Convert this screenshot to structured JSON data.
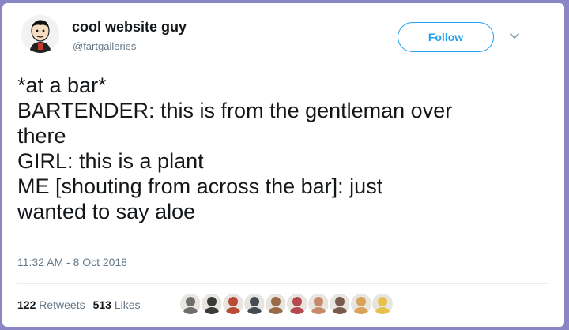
{
  "user": {
    "display_name": "cool website guy",
    "handle": "@fartgalleries"
  },
  "follow_button": {
    "label": "Follow"
  },
  "tweet": {
    "lines": [
      "*at a bar*",
      "BARTENDER: this is from the gentleman over",
      "there",
      "GIRL: this is a plant",
      "ME [shouting from across the bar]: just",
      "wanted to say aloe"
    ],
    "timestamp": "11:32 AM - 8 Oct 2018"
  },
  "stats": {
    "retweets_count": "122",
    "retweets_label": "Retweets",
    "likes_count": "513",
    "likes_label": "Likes"
  },
  "likers": [
    {
      "icon": "liker-avatar",
      "color": "#6d6d6d"
    },
    {
      "icon": "liker-avatar",
      "color": "#3a3a3a"
    },
    {
      "icon": "liker-avatar",
      "color": "#b94b35"
    },
    {
      "icon": "liker-avatar",
      "color": "#444b55"
    },
    {
      "icon": "liker-avatar",
      "color": "#9a6a45"
    },
    {
      "icon": "liker-avatar",
      "color": "#b5484f"
    },
    {
      "icon": "liker-avatar",
      "color": "#c7896a"
    },
    {
      "icon": "liker-avatar",
      "color": "#7a5a4a"
    },
    {
      "icon": "liker-avatar",
      "color": "#d9a15a"
    },
    {
      "icon": "liker-avatar",
      "color": "#e6c24a"
    }
  ],
  "colors": {
    "accent": "#1da1f2",
    "text": "#14171a",
    "secondary": "#657786",
    "background": "#8a86c6"
  }
}
